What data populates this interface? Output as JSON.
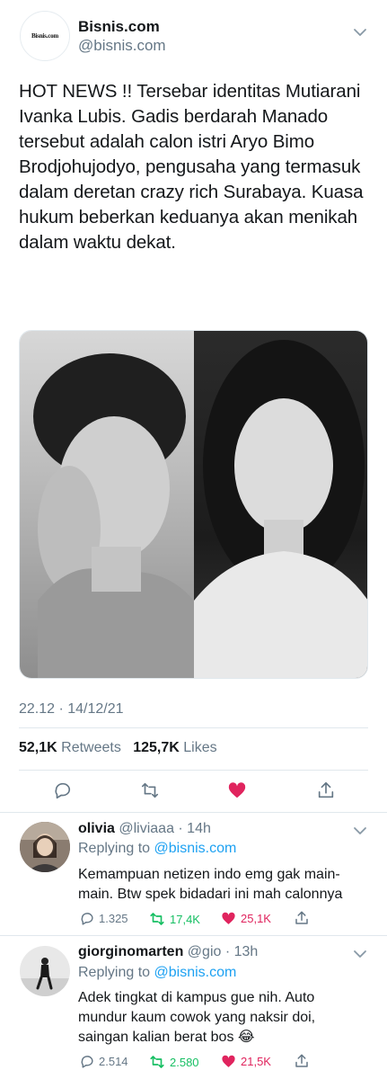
{
  "main_tweet": {
    "avatar_text": "Bisnis.com",
    "display_name": "Bisnis.com",
    "handle": "@bisnis.com",
    "text": "HOT NEWS !! Tersebar identitas Mutiarani Ivanka Lubis. Gadis berdarah Manado tersebut adalah calon istri Aryo Bimo Brodjohujodyo, pengusaha yang termasuk dalam deretan crazy rich Surabaya. Kuasa hukum beberkan keduanya akan menikah dalam waktu dekat.",
    "timestamp": "22.12 · 14/12/21",
    "retweets_count": "52,1K",
    "retweets_label": "Retweets",
    "likes_count": "125,7K",
    "likes_label": "Likes"
  },
  "actions": {
    "icons": [
      "reply-icon",
      "retweet-icon",
      "like-icon-filled",
      "share-icon"
    ],
    "like_color": "#e0245e"
  },
  "replies": [
    {
      "display_name": "olivia",
      "handle_time": "@liviaaa · 14h",
      "replying_label": "Replying to",
      "replying_to": "@bisnis.com",
      "text": "Kemampuan netizen indo emg gak main-main. Btw spek bidadari ini mah calonnya",
      "reply_count": "1.325",
      "retweet_count": "17,4K",
      "like_count": "25,1K"
    },
    {
      "display_name": "giorginomarten",
      "handle_time": "@gio · 13h",
      "replying_label": "Replying to",
      "replying_to": "@bisnis.com",
      "text": "Adek tingkat di kampus gue nih. Auto mundur kaum cowok yang naksir doi, saingan kalian berat bos 😂",
      "reply_count": "2.514",
      "retweet_count": "2.580",
      "like_count": "21,5K"
    }
  ],
  "colors": {
    "accent": "#1da1f2",
    "retweet_green": "#17bf63",
    "like_red": "#e0245e",
    "secondary_text": "#657786"
  }
}
